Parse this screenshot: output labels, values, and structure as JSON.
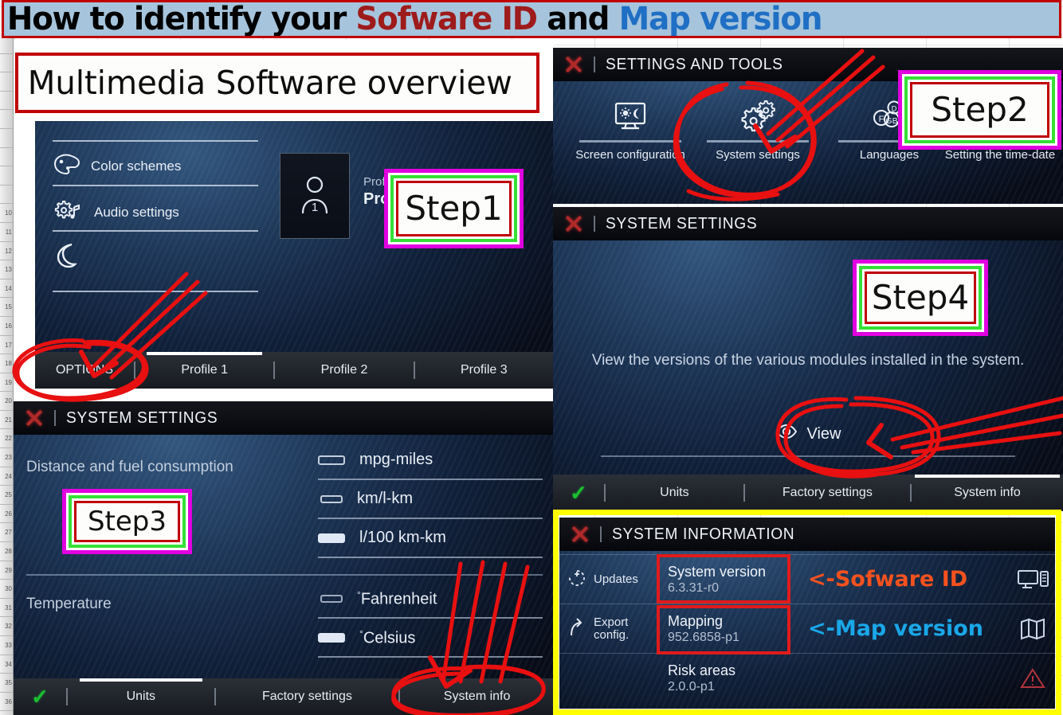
{
  "title": {
    "part1": "How to identify your ",
    "part2": "Sofware ID",
    "part3": " and ",
    "part4": "Map version",
    "colors": {
      "black": "#000000",
      "red": "#9e1b1b",
      "blue": "#1f6fc4",
      "banner_bg": "#a6c4dc",
      "banner_border": "#c00000"
    }
  },
  "overview": {
    "label": "Multimedia Software overview"
  },
  "steps": {
    "step1": "Step1",
    "step2": "Step2",
    "step3": "Step3",
    "step4": "Step4"
  },
  "screen1": {
    "items": [
      {
        "icon": "palette-icon",
        "label": "Color schemes"
      },
      {
        "icon": "gear-music-icon",
        "label": "Audio settings"
      },
      {
        "icon": "moon-icon",
        "label": ""
      }
    ],
    "profile": {
      "avatar": "person-1-icon",
      "caption": "Profile ac",
      "name": "Profile"
    },
    "tabs": [
      {
        "label": "OPTIONS",
        "active": false
      },
      {
        "label": "Profile 1",
        "active": true
      },
      {
        "label": "Profile 2",
        "active": false
      },
      {
        "label": "Profile 3",
        "active": false
      }
    ]
  },
  "screen2": {
    "header": {
      "close": "close-icon",
      "title": "SETTINGS AND TOOLS"
    },
    "tools": [
      {
        "icon": "screen-brightness-icon",
        "label": "Screen configuration"
      },
      {
        "icon": "gears-icon",
        "label": "System settings"
      },
      {
        "icon": "languages-icon",
        "label": "Languages"
      },
      {
        "icon": "clock-icon",
        "label": "Setting the time-date"
      }
    ]
  },
  "screen3": {
    "header": {
      "close": "close-icon",
      "title": "SYSTEM SETTINGS"
    },
    "groups": [
      {
        "label": "Distance and fuel consumption",
        "options": [
          {
            "label": "mpg-miles",
            "selected": false
          },
          {
            "label": "km/l-km",
            "selected": false
          },
          {
            "label": "l/100 km-km",
            "selected": true
          }
        ]
      },
      {
        "label": "Temperature",
        "options": [
          {
            "label": "Fahrenheit",
            "selected": false,
            "degree": true
          },
          {
            "label": "Celsius",
            "selected": true,
            "degree": true
          }
        ]
      }
    ],
    "tabs": [
      {
        "label": "check-icon",
        "active": false
      },
      {
        "label": "Units",
        "active": true
      },
      {
        "label": "Factory settings",
        "active": false
      },
      {
        "label": "System info",
        "active": false
      }
    ]
  },
  "screen4": {
    "header": {
      "close": "close-icon",
      "title": "SYSTEM SETTINGS"
    },
    "description": "View the versions of the various modules installed in the system.",
    "view_button": {
      "icon": "eye-icon",
      "label": "View"
    },
    "tabs": [
      {
        "label": "check-icon",
        "active": false
      },
      {
        "label": "Units",
        "active": false
      },
      {
        "label": "Factory settings",
        "active": false
      },
      {
        "label": "System info",
        "active": true
      }
    ]
  },
  "screen5": {
    "header": {
      "close": "close-icon",
      "title": "SYSTEM INFORMATION"
    },
    "rows": [
      {
        "left_icon": "updates-icon",
        "left_label": "Updates",
        "key": "System version",
        "value": "6.3.31-r0",
        "annotation": "<-Sofware ID",
        "annotation_color": "#f4511e",
        "right_icon": "monitor-icon",
        "highlighted": true
      },
      {
        "left_icon": "export-icon",
        "left_label": "Export config.",
        "key": "Mapping",
        "value": "952.6858-p1",
        "annotation": "<-Map version",
        "annotation_color": "#1aa7e8",
        "right_icon": "map-icon",
        "highlighted": true
      },
      {
        "left_icon": "",
        "left_label": "",
        "key": "Risk areas",
        "value": "2.0.0-p1",
        "annotation": "",
        "annotation_color": "",
        "right_icon": "warning-icon",
        "highlighted": false
      }
    ],
    "frame_color": "#ffff00"
  },
  "row_numbers": [
    "",
    "",
    "",
    "",
    "",
    "",
    "",
    "",
    "",
    "10",
    "11",
    "12",
    "13",
    "14",
    "15",
    "16",
    "17",
    "18",
    "19",
    "20",
    "21",
    "22",
    "23",
    "24",
    "25",
    "26",
    "27",
    "28",
    "29",
    "30",
    "31",
    "32",
    "33",
    "34",
    "35",
    "36"
  ]
}
